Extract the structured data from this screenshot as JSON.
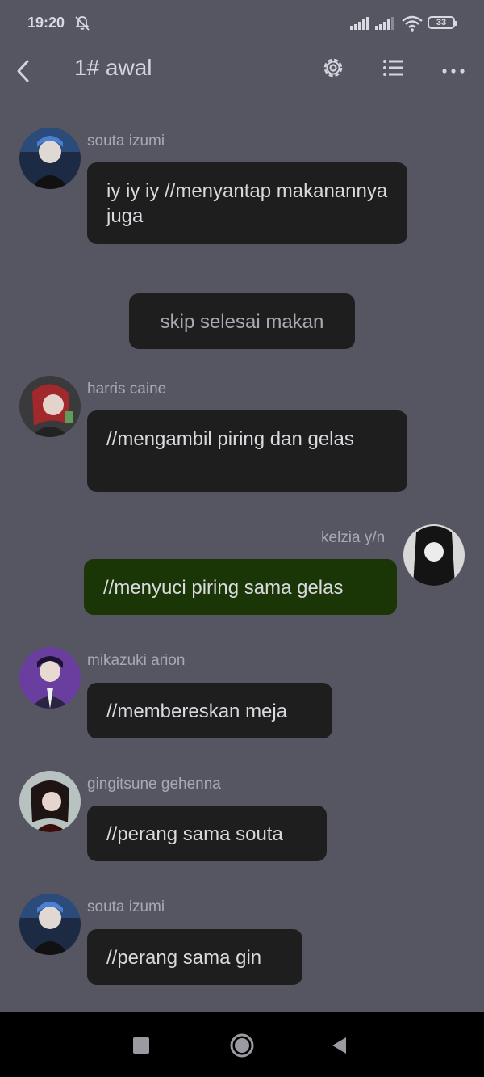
{
  "status_bar": {
    "time": "19:20",
    "battery": "33"
  },
  "header": {
    "title": "1# awal"
  },
  "messages": [
    {
      "sender": "souta izumi",
      "text": "iy iy iy //menyantap makanannya juga"
    },
    {
      "system": true,
      "text": "skip selesai makan"
    },
    {
      "sender": "harris caine",
      "text": "//mengambil piring dan gelas"
    },
    {
      "sender": "kelzia y/n",
      "text": "//menyuci piring sama gelas",
      "own": true
    },
    {
      "sender": "mikazuki arion",
      "text": "//membereskan meja"
    },
    {
      "sender": "gingitsune gehenna",
      "text": "//perang sama souta"
    },
    {
      "sender": "souta izumi",
      "text": "//perang sama gin"
    }
  ],
  "colors": {
    "background": "#565663",
    "bubble": "#1e1e1f",
    "own_bubble": "#1a3606"
  },
  "icons": {
    "status": [
      "bell-off-icon",
      "signal-icon",
      "signal-icon",
      "wifi-icon",
      "battery-icon"
    ],
    "header": [
      "back-icon",
      "gear-icon",
      "list-icon",
      "more-icon"
    ],
    "navbar": [
      "square-icon",
      "circle-icon",
      "triangle-back-icon"
    ]
  }
}
